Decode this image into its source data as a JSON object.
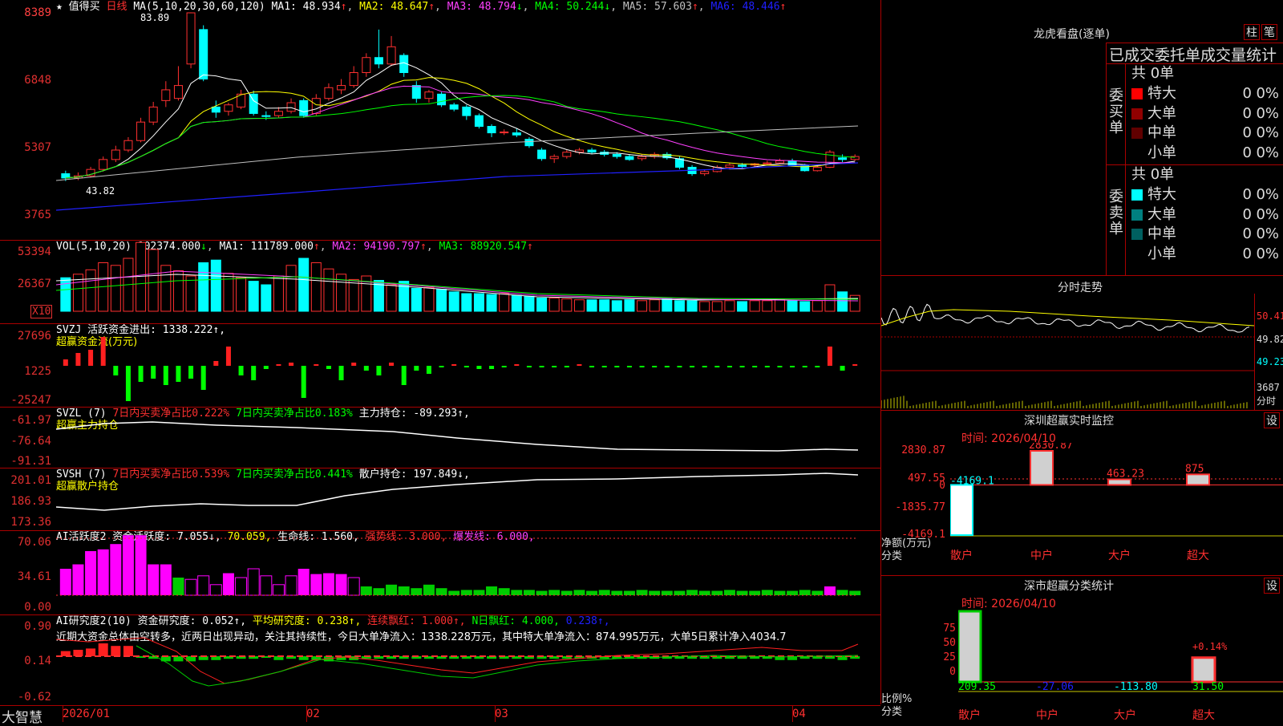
{
  "main": {
    "star": "★",
    "title": "值得买",
    "period": "日线",
    "ma_label": "MA(5,10,20,30,60,120)",
    "ma": [
      {
        "label": "MA1: 48.934",
        "arrow": "↑",
        "color": "#ffffff"
      },
      {
        "label": "MA2: 48.647",
        "arrow": "↑",
        "color": "#ffff00"
      },
      {
        "label": "MA3: 48.794",
        "arrow": "↓",
        "color": "#ff40ff"
      },
      {
        "label": "MA4: 50.244",
        "arrow": "↓",
        "color": "#00ff00"
      },
      {
        "label": "MA5: 57.603",
        "arrow": "↑",
        "color": "#c0c0c0"
      },
      {
        "label": "MA6: 48.446",
        "arrow": "↑",
        "color": "#2020ff"
      }
    ],
    "max_label": "83.89",
    "min_label": "43.82",
    "y_ticks": [
      "8389",
      "6848",
      "5307",
      "3765"
    ]
  },
  "vol": {
    "label": "VOL(5,10,20)",
    "value": "102374.000",
    "ma1": "MA1: 111789.000",
    "ma2": "MA2: 94190.797",
    "ma3": "MA3: 88920.547",
    "y_ticks": [
      "53394",
      "26367"
    ],
    "unit": "X10"
  },
  "svzj": {
    "label": "SVZJ  活跃资金进出: 1338.222↑,",
    "sub": "超赢资金流(万元)",
    "y_ticks": [
      "27696",
      "1225",
      "-25247"
    ]
  },
  "svzl": {
    "prefix": "SVZL (7)",
    "a": "7日内买卖净占比0.222%",
    "b": "7日内买卖净占比0.183%",
    "c": "主力持仓: -89.293↑,",
    "sub": "超赢主力持仓",
    "y_ticks": [
      "-61.97",
      "-76.64",
      "-91.31"
    ]
  },
  "svsh": {
    "prefix": "SVSH (7)",
    "a": "7日内买卖净占比0.539%",
    "b": "7日内买卖净占比0.441%",
    "c": "散户持仓: 197.849↓,",
    "sub": "超赢散户持仓",
    "y_ticks": [
      "201.01",
      "186.93",
      "173.36"
    ]
  },
  "ai": {
    "a": "AI活跃度2 资金活跃度: 7.055↓,",
    "b": "70.059,",
    "c": "生命线: 1.560,",
    "d": "强势线: 3.000,",
    "e": "爆发线: 6.000,",
    "y_ticks": [
      "70.06",
      "34.61",
      "0.00"
    ]
  },
  "research": {
    "a": "AI研究度2(10) 资金研究度: 0.052↑,",
    "b": "平均研究度: 0.238↑,",
    "c": "连续飘红: 1.000↑,",
    "d": "N日飘红: 4.000,",
    "e": "0.238↑,",
    "note": "近期大资金总体由空转多，近两日出现异动，关注其持续性，今日大单净流入：1338.228万元，其中特大单净流入：874.995万元，大单5日累计净入4034.7",
    "y_ticks": [
      "0.90",
      "0.14",
      "-0.62"
    ]
  },
  "xaxis": {
    "brand": "大智慧",
    "labels": [
      "2026/01",
      "02",
      "03",
      "04"
    ]
  },
  "right": {
    "lhb": {
      "title": "龙虎看盘(逐单)",
      "btn1": "柱",
      "btn2": "笔",
      "head": "已成交委托单成交量统计",
      "buy_label": "委买单",
      "sell_label": "委卖单",
      "buy_total": "共 0单",
      "sell_total": "共 0单",
      "buy_rows": [
        {
          "name": "特大",
          "n": "0",
          "p": "0%",
          "color": "#ff0000"
        },
        {
          "name": "大单",
          "n": "0",
          "p": "0%",
          "color": "#900000"
        },
        {
          "name": "中单",
          "n": "0",
          "p": "0%",
          "color": "#600000"
        },
        {
          "name": "小单",
          "n": "0",
          "p": "0%",
          "color": "#000000"
        }
      ],
      "sell_rows": [
        {
          "name": "特大",
          "n": "0",
          "p": "0%",
          "color": "#00ffff"
        },
        {
          "name": "大单",
          "n": "0",
          "p": "0%",
          "color": "#008080"
        },
        {
          "name": "中单",
          "n": "0",
          "p": "0%",
          "color": "#006060"
        },
        {
          "name": "小单",
          "n": "0",
          "p": "0%",
          "color": "#000000"
        }
      ]
    },
    "fs": {
      "title": "分时走势",
      "p1": "50.41",
      "p2": "49.82",
      "p3": "49.23",
      "vol": "3687",
      "vol_unit": "分时"
    },
    "mon": {
      "title": "深圳超赢实时监控",
      "btn": "设",
      "time": "时间: 2026/04/10",
      "y_ticks": [
        "2830.87",
        "497.55",
        "0",
        "-1835.77",
        "-4169.1"
      ],
      "axis_title": "净额(万元)",
      "axis_sub": "分类",
      "cats": [
        "散户",
        "中户",
        "大户",
        "超大"
      ],
      "chart_data": {
        "type": "bar",
        "categories": [
          "散户",
          "中户",
          "大户",
          "超大"
        ],
        "values": [
          -4169.1,
          2830.87,
          463.23,
          875
        ],
        "labels": [
          "-4169.1",
          "2830.87",
          "463.23",
          "875"
        ],
        "ylim": [
          -4169.1,
          2830.87
        ]
      }
    },
    "cls": {
      "title": "深市超赢分类统计",
      "btn": "设",
      "time": "时间: 2026/04/10",
      "y_ticks": [
        "75",
        "50",
        "25",
        "0"
      ],
      "axis_title": "比例%",
      "axis_sub": "分类",
      "cats": [
        "散户",
        "中户",
        "大户",
        "超大"
      ],
      "values_text": [
        "209.35",
        "-27.06",
        "-113.80",
        "31.50"
      ],
      "pct_label": "+0.14%",
      "chart_data": {
        "type": "bar",
        "categories": [
          "散户",
          "中户",
          "大户",
          "超大"
        ],
        "values": [
          209.35,
          -27.06,
          -113.8,
          31.5
        ],
        "ylim": [
          0,
          75
        ]
      }
    }
  },
  "chart_data": {
    "type": "candlestick",
    "title": "值得买 日线",
    "x_labels": [
      "2026/01",
      "02",
      "03",
      "04"
    ],
    "ylim": [
      37.65,
      83.89
    ],
    "ohlc": [
      [
        46.5,
        45.5,
        47.2,
        44.8
      ],
      [
        45.5,
        46.0,
        46.8,
        45.0
      ],
      [
        46.0,
        47.5,
        48.1,
        45.6
      ],
      [
        47.5,
        49.8,
        50.5,
        47.0
      ],
      [
        49.8,
        52.0,
        53.0,
        49.2
      ],
      [
        52.0,
        54.2,
        55.0,
        51.5
      ],
      [
        54.2,
        58.5,
        59.5,
        53.8
      ],
      [
        58.5,
        62.0,
        63.2,
        57.8
      ],
      [
        63.5,
        66.0,
        68.0,
        62.0
      ],
      [
        64.0,
        67.0,
        71.5,
        63.5
      ],
      [
        72.0,
        83.89,
        84.0,
        71.0
      ],
      [
        80.0,
        68.5,
        81.0,
        68.0
      ],
      [
        62.0,
        60.8,
        63.5,
        59.5
      ],
      [
        61.0,
        62.5,
        63.0,
        60.0
      ],
      [
        62.0,
        65.0,
        66.0,
        61.5
      ],
      [
        65.0,
        60.5,
        65.8,
        60.0
      ],
      [
        60.0,
        59.8,
        61.0,
        59.0
      ],
      [
        60.0,
        61.0,
        62.0,
        59.5
      ],
      [
        61.0,
        63.0,
        64.0,
        60.5
      ],
      [
        63.5,
        60.0,
        64.0,
        59.5
      ],
      [
        60.5,
        64.0,
        65.0,
        60.0
      ],
      [
        64.0,
        66.5,
        67.5,
        63.5
      ],
      [
        66.0,
        67.0,
        68.5,
        65.0
      ],
      [
        67.0,
        70.0,
        71.5,
        66.5
      ],
      [
        70.0,
        73.5,
        74.5,
        69.0
      ],
      [
        73.5,
        72.0,
        80.0,
        71.0
      ],
      [
        72.0,
        76.0,
        78.5,
        71.5
      ],
      [
        74.0,
        70.0,
        74.5,
        69.0
      ],
      [
        67.0,
        64.0,
        68.0,
        63.0
      ],
      [
        64.0,
        65.5,
        66.0,
        63.0
      ],
      [
        65.0,
        62.5,
        65.5,
        62.0
      ],
      [
        62.5,
        61.5,
        63.0,
        61.0
      ],
      [
        62.0,
        60.0,
        62.5,
        59.0
      ],
      [
        60.0,
        57.5,
        60.5,
        57.0
      ],
      [
        57.5,
        56.0,
        58.0,
        55.0
      ],
      [
        56.0,
        56.2,
        56.8,
        55.5
      ],
      [
        56.0,
        55.5,
        57.0,
        55.0
      ],
      [
        54.5,
        53.0,
        55.0,
        52.5
      ],
      [
        52.0,
        50.0,
        52.5,
        49.5
      ],
      [
        50.0,
        50.5,
        51.0,
        49.0
      ],
      [
        50.5,
        51.5,
        52.0,
        50.0
      ],
      [
        51.5,
        52.0,
        52.5,
        51.0
      ],
      [
        52.0,
        51.5,
        52.5,
        51.0
      ],
      [
        51.5,
        51.0,
        52.0,
        50.5
      ],
      [
        51.0,
        50.5,
        51.5,
        50.0
      ],
      [
        50.5,
        49.8,
        51.0,
        49.5
      ],
      [
        50.0,
        50.5,
        51.0,
        49.5
      ],
      [
        50.5,
        51.0,
        51.5,
        50.0
      ],
      [
        51.0,
        50.2,
        51.5,
        49.8
      ],
      [
        50.0,
        48.0,
        50.5,
        47.5
      ],
      [
        48.0,
        46.5,
        48.5,
        46.0
      ],
      [
        46.5,
        47.0,
        47.5,
        46.0
      ],
      [
        47.0,
        48.0,
        48.5,
        46.8
      ],
      [
        48.0,
        48.5,
        49.0,
        47.5
      ],
      [
        48.5,
        48.2,
        49.0,
        47.8
      ],
      [
        48.5,
        48.8,
        49.0,
        48.0
      ],
      [
        48.8,
        49.0,
        49.5,
        48.5
      ],
      [
        49.0,
        49.5,
        50.0,
        48.8
      ],
      [
        49.5,
        48.5,
        50.0,
        48.2
      ],
      [
        48.5,
        47.2,
        48.8,
        47.0
      ],
      [
        47.2,
        48.0,
        48.5,
        47.0
      ],
      [
        48.0,
        51.5,
        52.0,
        47.8
      ],
      [
        50.2,
        49.8,
        51.0,
        49.2
      ],
      [
        49.8,
        50.5,
        51.0,
        49.5
      ]
    ]
  }
}
